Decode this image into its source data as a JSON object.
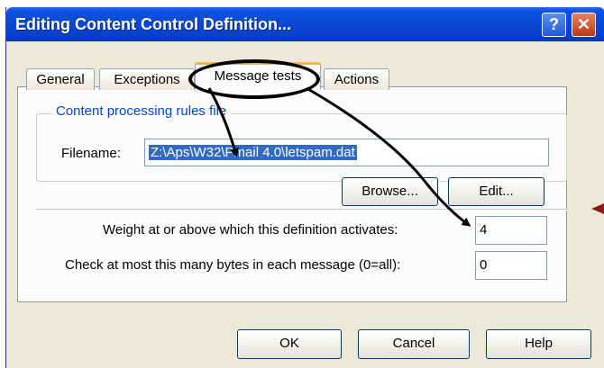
{
  "window": {
    "title": "Editing Content Control Definition...",
    "help_glyph": "?",
    "close_glyph": "✕"
  },
  "tabs": [
    {
      "label": "General"
    },
    {
      "label": "Exceptions"
    },
    {
      "label": "Message tests",
      "active": true
    },
    {
      "label": "Actions"
    }
  ],
  "group": {
    "label": "Content processing rules file"
  },
  "filename": {
    "label": "Filename:",
    "value": "Z:\\Aps\\W32\\Pmail 4.0\\letspam.dat"
  },
  "buttons": {
    "browse": "Browse...",
    "edit": "Edit...",
    "ok": "OK",
    "cancel": "Cancel",
    "help": "Help"
  },
  "weight": {
    "label": "Weight at or above which this definition activates:",
    "value": "4"
  },
  "bytes": {
    "label": "Check at most this many bytes in each message (0=all):",
    "value": "0"
  },
  "colors": {
    "title_bar": "#0a46d2",
    "dialog_bg": "#ece9d8",
    "selection": "#316ac5",
    "annotation_arrow": "#8b1a1a"
  }
}
